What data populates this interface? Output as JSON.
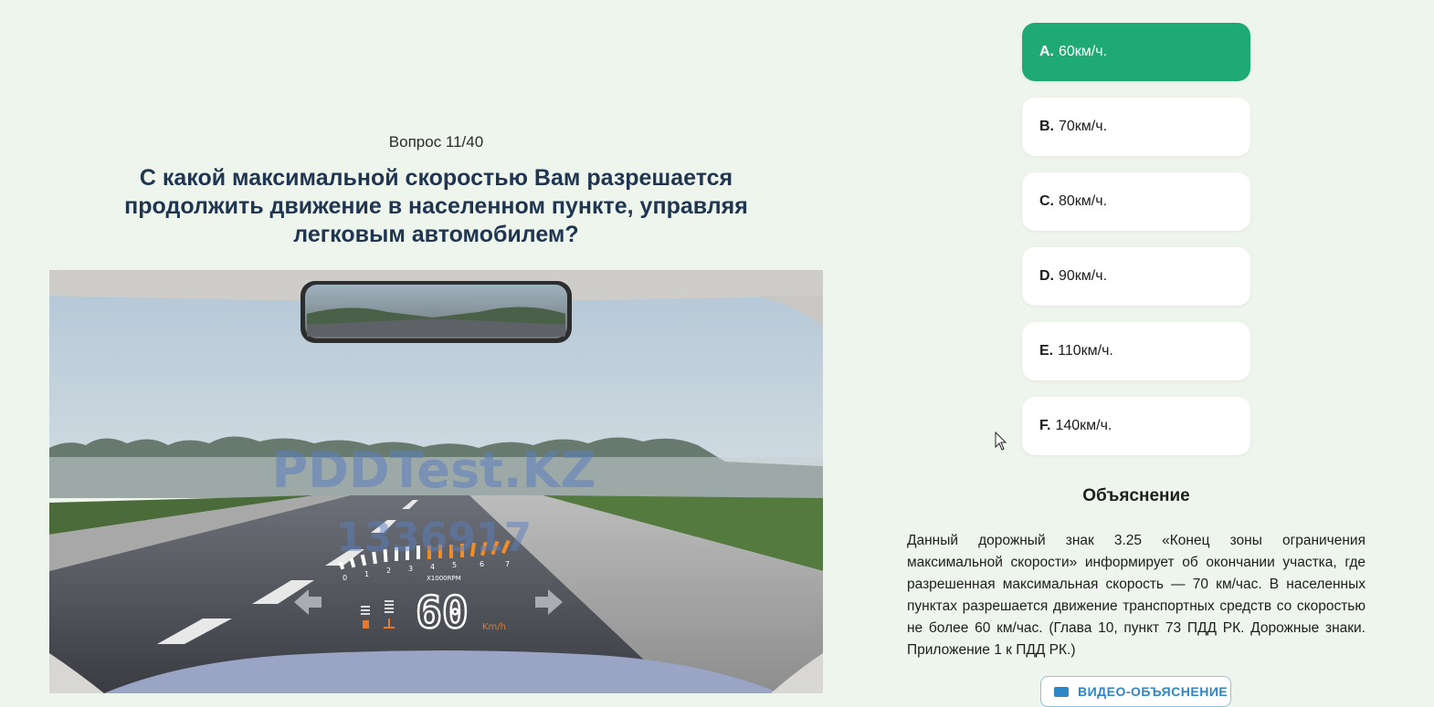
{
  "question": {
    "counter": "Вопрос 11/40",
    "text": "С какой максимальной скоростью Вам разрешается продолжить движение в населенном пункте, управляя легковым автомобилем?"
  },
  "image": {
    "watermark_site": "PDDTest.KZ",
    "watermark_id": "1336917",
    "hud": {
      "speed": "60",
      "speed_unit": "Km/h",
      "rpm_label": "X1000RPM",
      "rpm_ticks": [
        "0",
        "1",
        "2",
        "3",
        "4",
        "5",
        "6",
        "7"
      ]
    }
  },
  "answers": [
    {
      "letter": "A.",
      "text": "60км/ч.",
      "correct": true
    },
    {
      "letter": "B.",
      "text": "70км/ч.",
      "correct": false
    },
    {
      "letter": "C.",
      "text": "80км/ч.",
      "correct": false
    },
    {
      "letter": "D.",
      "text": "90км/ч.",
      "correct": false
    },
    {
      "letter": "E.",
      "text": "110км/ч.",
      "correct": false
    },
    {
      "letter": "F.",
      "text": "140км/ч.",
      "correct": false
    }
  ],
  "explanation": {
    "title": "Объяснение",
    "text": "Данный дорожный знак 3.25 «Конец зоны ограничения максимальной скорости» информирует об окончании участка, где разрешенная максимальная скорость — 70 км/час. В населенных пунктах разрешается движение транспортных средств со скоростью не более 60 км/час. (Глава 10, пункт 73 ПДД РК. Дорожные знаки. Приложение 1 к ПДД РК.)",
    "video_button": "ВИДЕО-ОБЪЯСНЕНИЕ"
  },
  "colors": {
    "page_bg": "#eef5ec",
    "correct_answer": "#1eaa72",
    "question_text": "#1f3550",
    "video_button": "#2f86c6"
  }
}
